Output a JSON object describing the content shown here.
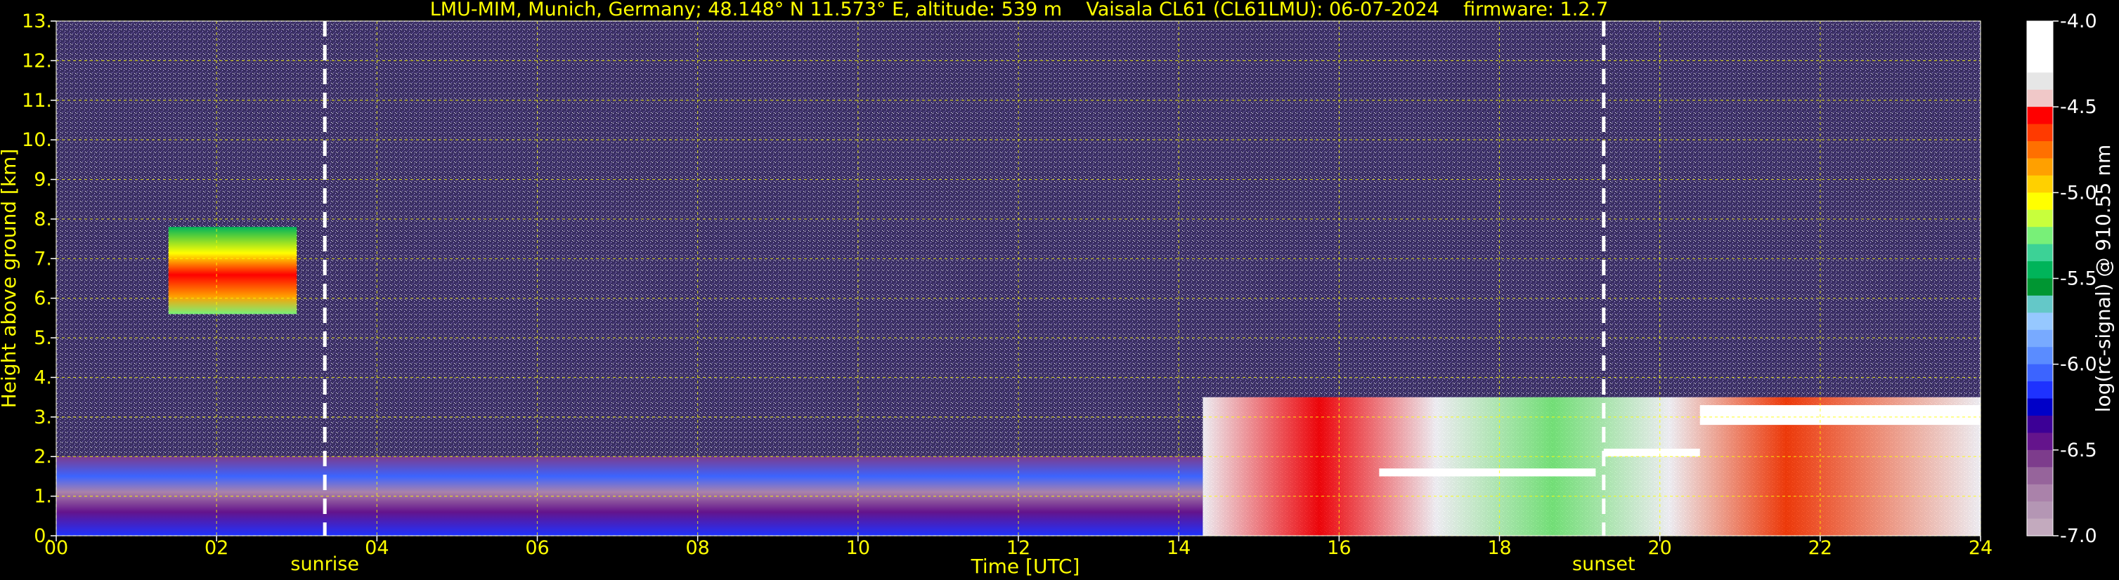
{
  "chart_data": {
    "type": "heatmap",
    "title": "LMU-MIM, Munich, Germany; 48.148° N 11.573° E, altitude: 539 m    Vaisala CL61 (CL61LMU): 06-07-2024    firmware: 1.2.7",
    "xlabel": "Time [UTC]",
    "ylabel": "Height above ground [km]",
    "xlim": [
      0,
      24
    ],
    "ylim": [
      0,
      13
    ],
    "x_ticks": [
      0,
      2,
      4,
      6,
      8,
      10,
      12,
      14,
      16,
      18,
      20,
      22,
      24
    ],
    "x_tick_labels": [
      "00",
      "02",
      "04",
      "06",
      "08",
      "10",
      "12",
      "14",
      "16",
      "18",
      "20",
      "22",
      "24"
    ],
    "y_ticks": [
      0,
      1,
      2,
      3,
      4,
      5,
      6,
      7,
      8,
      9,
      10,
      11,
      12,
      13
    ],
    "y_tick_labels": [
      "0.",
      "1.",
      "2.",
      "3.",
      "4.",
      "5.",
      "6.",
      "7.",
      "8.",
      "9.",
      "10.",
      "11.",
      "12.",
      "13."
    ],
    "grid": true,
    "events": [
      {
        "label": "sunrise",
        "time_utc": 3.35
      },
      {
        "label": "sunset",
        "time_utc": 19.3
      }
    ],
    "colorbar": {
      "label": "log(rc-signal) @ 910.55 nm",
      "range": [
        -7.0,
        -4.0
      ],
      "tick_values": [
        -4.0,
        -4.5,
        -5.0,
        -5.5,
        -6.0,
        -6.5,
        -7.0
      ],
      "tick_labels": [
        "-4.0",
        "-4.5",
        "-5.0",
        "-5.5",
        "-6.0",
        "-6.5",
        "-7.0"
      ],
      "colors_top_to_bottom": [
        "#ffffff",
        "#ffffff",
        "#ffffff",
        "#e6e6e6",
        "#f0c8c8",
        "#ff0000",
        "#ff3a00",
        "#ff7000",
        "#ffa000",
        "#ffd000",
        "#ffff00",
        "#c8ff3c",
        "#78f078",
        "#3cd296",
        "#00b45a",
        "#009632",
        "#64c8c8",
        "#96c8ff",
        "#78aaff",
        "#5a8cff",
        "#3c64ff",
        "#1e32ff",
        "#0000c8",
        "#3c0096",
        "#64148c",
        "#7d3c8c",
        "#96649b",
        "#aa82aa",
        "#b496b4",
        "#c3aabe"
      ]
    },
    "features": [
      {
        "name": "boundary_layer_aerosol",
        "x_range": [
          0,
          14.3
        ],
        "height_km": [
          0,
          2.0
        ],
        "log_signal": -6.2
      },
      {
        "name": "cirrus_cloud",
        "x_range": [
          1.4,
          3.0
        ],
        "height_km": [
          5.6,
          7.8
        ],
        "log_signal": -5.0
      },
      {
        "name": "low_clouds",
        "x_range": [
          14.3,
          24
        ],
        "height_km": [
          0,
          3.5
        ],
        "log_signal": -4.5
      },
      {
        "name": "cloud_top_layer",
        "x_range": [
          16.5,
          19.2
        ],
        "height_km": [
          1.5,
          1.7
        ],
        "log_signal": -4.0
      },
      {
        "name": "cloud_top_layer",
        "x_range": [
          19.3,
          20.5
        ],
        "height_km": [
          2.0,
          2.2
        ],
        "log_signal": -4.0
      },
      {
        "name": "cloud_top_layer",
        "x_range": [
          20.5,
          24
        ],
        "height_km": [
          2.8,
          3.3
        ],
        "log_signal": -4.0
      }
    ]
  }
}
